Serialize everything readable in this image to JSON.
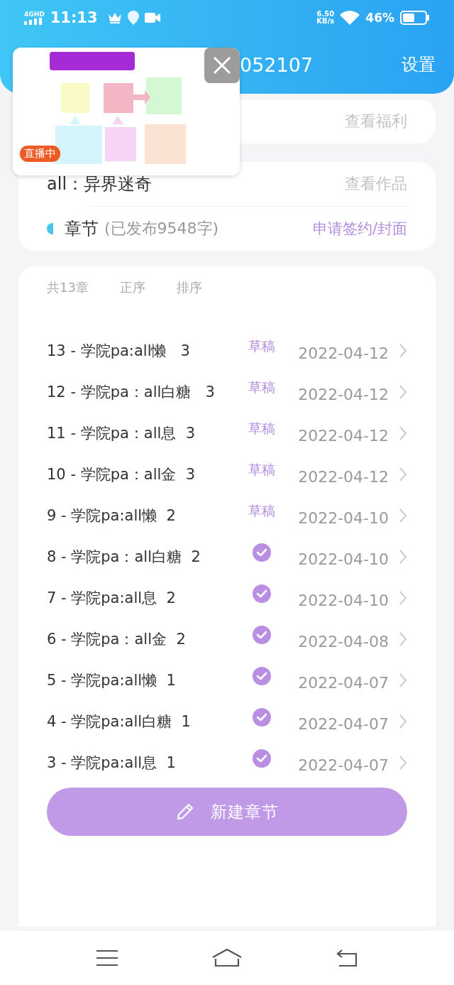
{
  "status_bar": {
    "network": "4G",
    "network_badge": "HD",
    "time": "11:13",
    "speed": "6.50",
    "speed_unit": "KB/s",
    "battery": "46%"
  },
  "header": {
    "title": "052107",
    "settings": "设置"
  },
  "live_overlay": {
    "badge": "直播中"
  },
  "benefits_card": {
    "link": "查看福利"
  },
  "work_card": {
    "title": "all：异界迷奇",
    "view_link": "查看作品",
    "section": "章节",
    "section_count": "(已发布9548字)",
    "apply_link": "申请签约/封面"
  },
  "chapters": {
    "total": "共13章",
    "order": "正序",
    "sort": "排序",
    "rows": [
      {
        "title": "13 - 学院pa:all懒   3",
        "kind": "draft",
        "tag": "草稿",
        "date": "2022-04-12"
      },
      {
        "title": "12 - 学院pa：all白糖   3",
        "kind": "draft",
        "tag": "草稿",
        "date": "2022-04-12"
      },
      {
        "title": "11 - 学院pa：all息  3",
        "kind": "draft",
        "tag": "草稿",
        "date": "2022-04-12"
      },
      {
        "title": "10 - 学院pa：all金  3",
        "kind": "draft",
        "tag": "草稿",
        "date": "2022-04-12"
      },
      {
        "title": "9 - 学院pa:all懒  2",
        "kind": "draft",
        "tag": "草稿",
        "date": "2022-04-10"
      },
      {
        "title": "8 - 学院pa：all白糖  2",
        "kind": "published",
        "date": "2022-04-10"
      },
      {
        "title": "7 - 学院pa:all息  2",
        "kind": "published",
        "date": "2022-04-10"
      },
      {
        "title": "6 - 学院pa：all金  2",
        "kind": "published",
        "date": "2022-04-08"
      },
      {
        "title": "5 - 学院pa:all懒  1",
        "kind": "published",
        "date": "2022-04-07"
      },
      {
        "title": "4 - 学院pa:all白糖  1",
        "kind": "published",
        "date": "2022-04-07"
      },
      {
        "title": "3 - 学院pa:all息  1",
        "kind": "published",
        "date": "2022-04-07"
      }
    ]
  },
  "new_chapter_button": "新建章节"
}
